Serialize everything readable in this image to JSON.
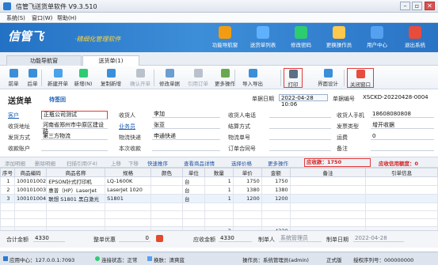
{
  "window": {
    "title": "信管飞送货单软件 V9.3.510",
    "min": "–",
    "max": "▫",
    "close": "✕"
  },
  "menu": [
    "系统(S)",
    "窗口(W)",
    "帮助(H)"
  ],
  "banner": {
    "logo": "信管飞",
    "slogan": "·精细化管理软件",
    "buttons": [
      {
        "label": "功能导航窗",
        "icon": "navigation-icon",
        "color": "#f39c12"
      },
      {
        "label": "送货单列表",
        "icon": "list-icon",
        "color": "#5fb0ff"
      },
      {
        "label": "修改密码",
        "icon": "key-icon",
        "color": "#2ecc71"
      },
      {
        "label": "更换操作员",
        "icon": "user-switch-icon",
        "color": "#ffc94d"
      },
      {
        "label": "用户中心",
        "icon": "user-center-icon",
        "color": "#56a0f2"
      },
      {
        "label": "退出系统",
        "icon": "power-icon",
        "color": "#e74c3c"
      }
    ]
  },
  "tabs": [
    "功能导航窗",
    "送货单(1)"
  ],
  "toolbar": [
    {
      "label": "前单",
      "icon": "prev-icon",
      "color": "#3b8fd9",
      "dim": false
    },
    {
      "label": "后单",
      "icon": "next-icon",
      "color": "#3b8fd9",
      "dim": false
    },
    {
      "label": "新建开单",
      "icon": "new-icon",
      "color": "#4aa3e8",
      "dim": false
    },
    {
      "label": "新增(N)",
      "icon": "add-icon",
      "color": "#2ecc71",
      "dim": false
    },
    {
      "label": "复制新增",
      "icon": "copy-icon",
      "color": "#3b8fd9",
      "dim": false
    },
    {
      "label": "确认开单",
      "icon": "confirm-icon",
      "color": "#b9c2cc",
      "dim": true
    },
    {
      "label": "修改单据",
      "icon": "edit-icon",
      "color": "#6c9ed0",
      "dim": false
    },
    {
      "label": "引用订单",
      "icon": "reference-icon",
      "color": "#b9c2cc",
      "dim": true
    },
    {
      "label": "更多操作",
      "icon": "more-icon",
      "color": "#6aa84f",
      "dim": false
    },
    {
      "label": "导入导出",
      "icon": "import-export-icon",
      "color": "#3b8fd9",
      "dim": false
    },
    {
      "label": "打印",
      "icon": "print-icon",
      "color": "#5c6f87",
      "dim": false
    },
    {
      "label": "界面设计",
      "icon": "design-icon",
      "color": "#3b8fd9",
      "dim": false
    },
    {
      "label": "关闭窗口",
      "icon": "close-window-icon",
      "color": "#e74c3c",
      "dim": false
    }
  ],
  "form": {
    "title": "送货单",
    "status": "待签回",
    "date_label": "单据日期",
    "date_value": "2022-04-28 10:06",
    "number_label": "单据编号",
    "number_value": "XSCKD-20220428-0004",
    "fields": [
      {
        "label": "客户",
        "value": "正瓶公司测试",
        "blue": true
      },
      {
        "label": "收货地址",
        "value": "河南省郑州市中原区建设路",
        "blue": false
      },
      {
        "label": "发货方式",
        "value": "第三方物流",
        "blue": false
      },
      {
        "label": "收款账户",
        "value": "",
        "blue": false
      },
      {
        "label": "收货人",
        "value": "李加",
        "blue": false
      },
      {
        "label": "业务员",
        "value": "张亚",
        "blue": true
      },
      {
        "label": "物流快递",
        "value": "申通快递",
        "blue": false
      },
      {
        "label": "本次收款",
        "value": "",
        "blue": false
      },
      {
        "label": "收货人电话",
        "value": "",
        "blue": false
      },
      {
        "label": "结算方式",
        "value": "",
        "blue": false
      },
      {
        "label": "物流单号",
        "value": "",
        "blue": false
      },
      {
        "label": "订单合同号",
        "value": "",
        "blue": false
      },
      {
        "label": "收货人手机",
        "value": "18608080808",
        "blue": false
      },
      {
        "label": "发票类型",
        "value": "增开收据",
        "blue": false
      },
      {
        "label": "运费",
        "value": "0",
        "blue": false
      },
      {
        "label": "备注",
        "value": "",
        "blue": false
      }
    ]
  },
  "gridbar": {
    "items": [
      "添加明细",
      "删除明细",
      "扫描引用(F4)",
      "上移",
      "下移",
      "快速推序"
    ],
    "right_items": [
      "查看商品详情",
      "选择价格",
      "更多操作"
    ],
    "receivable": "应收款：1750",
    "credit": "应收信用额度：0"
  },
  "table": {
    "headers": [
      "序号",
      "商品编码",
      "商品名称",
      "规格",
      "颜色",
      "单位",
      "数量",
      "单价",
      "金额",
      "备注",
      "引单信息"
    ],
    "rows": [
      [
        "1",
        "100101002",
        "EPSON针式打印机",
        "LQ-1600K",
        "",
        "台",
        "1",
        "1750",
        "1750",
        "",
        ""
      ],
      [
        "2",
        "100101003",
        "惠普（HP）LaserJet",
        "LaserJet 1020",
        "",
        "台",
        "1",
        "1380",
        "1380",
        "",
        ""
      ],
      [
        "3",
        "100101004",
        "联想 S1801 黑白激光",
        "S1801",
        "",
        "台",
        "1",
        "1200",
        "1200",
        "",
        ""
      ]
    ],
    "total_qty": "3",
    "total_amount": "4330"
  },
  "totals": {
    "sum_label": "合计金额",
    "sum_value": "4330",
    "discount_label": "整单优惠",
    "discount_value": "0",
    "receivable_label": "应收金额",
    "receivable_value": "4330",
    "maker_label": "制单人",
    "maker_value": "系统管理员",
    "make_date_label": "制单日期",
    "make_date_value": "2022-04-28"
  },
  "status": {
    "app_center": "应用中心：127.0.0.1:7093",
    "conn": "连接状态：正常",
    "theme": "换肤：清爽蓝",
    "operator": "操作员：系统管理员(admin)",
    "version": "正式版",
    "license": "授权序列号：000000000"
  }
}
